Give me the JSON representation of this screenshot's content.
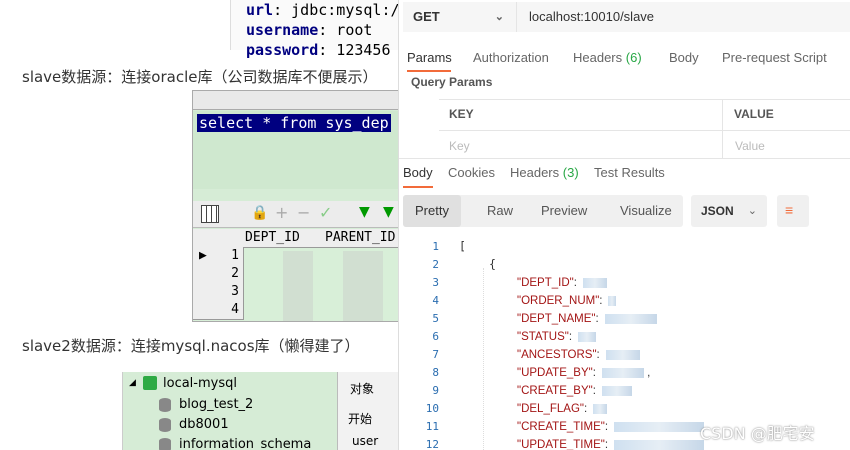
{
  "article": {
    "config_lines": [
      {
        "key": "url",
        "sep": ":",
        "value": " jdbc:mysql:/"
      },
      {
        "key": "username",
        "sep": ":",
        "value": " root"
      },
      {
        "key": "password",
        "sep": ":",
        "value": " 123456"
      }
    ],
    "caption_slave": "slave数据源：连接oracle库（公司数据库不便展示）",
    "caption_slave2": "slave2数据源：连接mysql.nacos库（懒得建了）",
    "plsql": {
      "sql_text": "select * from sys_dep",
      "columns": [
        "DEPT_ID",
        "PARENT_ID"
      ],
      "row_numbers": [
        "1",
        "2",
        "3",
        "4"
      ]
    },
    "navicat": {
      "connection": "local-mysql",
      "databases": [
        "blog_test_2",
        "db8001",
        "information_schema"
      ],
      "side_tab": "对象",
      "side_btn": "开始",
      "side_user": "user"
    },
    "watermark": "CSDN @肥宅安"
  },
  "postman": {
    "method": "GET",
    "url": "localhost:10010/slave",
    "request_tabs": [
      {
        "label": "Params",
        "count": ""
      },
      {
        "label": "Authorization",
        "count": ""
      },
      {
        "label": "Headers",
        "count": "(6)"
      },
      {
        "label": "Body",
        "count": ""
      },
      {
        "label": "Pre-request Script",
        "count": ""
      }
    ],
    "query_params_title": "Query Params",
    "params_table": {
      "key_header": "KEY",
      "value_header": "VALUE",
      "key_placeholder": "Key",
      "value_placeholder": "Value"
    },
    "response_tabs": [
      {
        "label": "Body",
        "count": ""
      },
      {
        "label": "Cookies",
        "count": ""
      },
      {
        "label": "Headers",
        "count": "(3)"
      },
      {
        "label": "Test Results",
        "count": ""
      }
    ],
    "format_tabs": [
      "Pretty",
      "Raw",
      "Preview",
      "Visualize"
    ],
    "format_select": "JSON",
    "line_numbers": [
      "1",
      "2",
      "3",
      "4",
      "5",
      "6",
      "7",
      "8",
      "9",
      "10",
      "11",
      "12"
    ],
    "json_keys": [
      "\"DEPT_ID\"",
      "\"ORDER_NUM\"",
      "\"DEPT_NAME\"",
      "\"STATUS\"",
      "\"ANCESTORS\"",
      "\"UPDATE_BY\"",
      "\"CREATE_BY\"",
      "\"DEL_FLAG\"",
      "\"CREATE_TIME\"",
      "\"UPDATE_TIME\""
    ],
    "open_bracket": "[",
    "open_brace": "{",
    "accent_color": "#f26b3a"
  }
}
